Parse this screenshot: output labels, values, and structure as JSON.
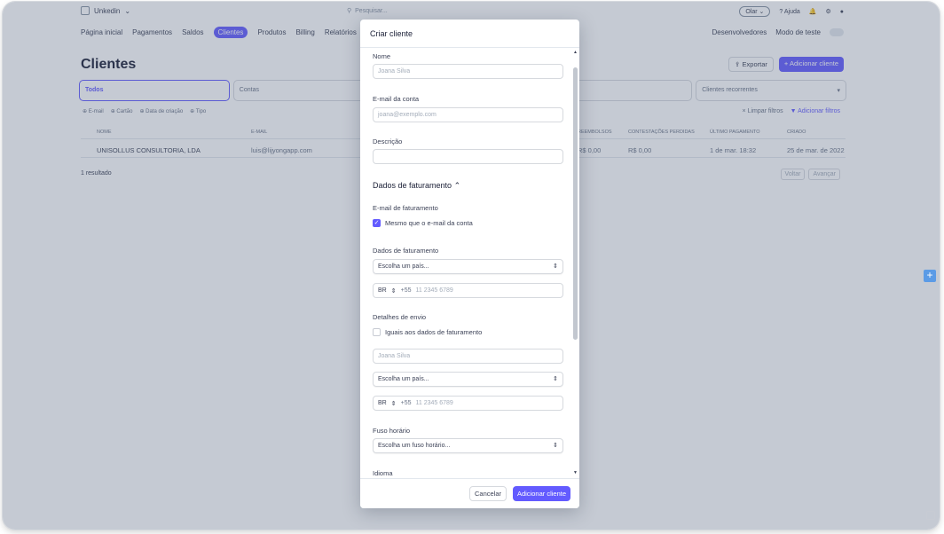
{
  "topbar": {
    "account_name": "Unkedin",
    "search_placeholder": "Pesquisar...",
    "pill": "Olar",
    "help": "Ajuda"
  },
  "nav": {
    "tabs": [
      "Página inicial",
      "Pagamentos",
      "Saldos",
      "Clientes",
      "Produtos",
      "Billing",
      "Relatórios"
    ],
    "active_index": 3,
    "developers": "Desenvolvedores",
    "test_mode": "Modo de teste"
  },
  "page": {
    "title": "Clientes",
    "export": "Exportar",
    "add_customer": "Adicionar cliente",
    "filter_cards": [
      "Todos",
      "Contas",
      "",
      "entes",
      "Clientes recorrentes"
    ],
    "chips": [
      "E-mail",
      "Cartão",
      "Data de criação",
      "Tipo"
    ],
    "clear_filters": "Limpar filtros",
    "add_filters": "Adicionar filtros",
    "columns": [
      "NOME",
      "E-MAIL",
      "REEMBOLSOS",
      "CONTESTAÇÕES PERDIDAS",
      "ÚLTIMO PAGAMENTO",
      "CRIADO"
    ],
    "rows": [
      {
        "name": "UNISOLLUS CONSULTORIA, LDA",
        "email": "luis@lijyongapp.com",
        "refunds": "R$ 0,00",
        "disputes": "R$ 0,00",
        "last_payment": "1 de mar. 18:32",
        "created": "25 de mar. de 2022"
      }
    ],
    "result_count": "1 resultado",
    "prev": "Voltar",
    "next": "Avançar"
  },
  "modal": {
    "title": "Criar cliente",
    "name_label": "Nome",
    "name_placeholder": "Joana Silva",
    "email_label": "E-mail da conta",
    "email_placeholder": "joana@exemplo.com",
    "description_label": "Descrição",
    "billing_section": "Dados de faturamento",
    "billing_email_label": "E-mail de faturamento",
    "same_email_label": "Mesmo que o e-mail da conta",
    "billing_data_label": "Dados de faturamento",
    "country_placeholder": "Escolha um país...",
    "phone_cc": "BR",
    "phone_prefix": "+55",
    "phone_placeholder": "11 2345 6789",
    "shipping_label": "Detalhes de envio",
    "same_billing_label": "Iguais aos dados de faturamento",
    "ship_name_placeholder": "Joana Silva",
    "ship_country_placeholder": "Escolha um país...",
    "ship_phone_cc": "BR",
    "ship_phone_prefix": "+55",
    "ship_phone_placeholder": "11 2345 6789",
    "timezone_label": "Fuso horário",
    "timezone_placeholder": "Escolha um fuso horário...",
    "language_label": "Idioma",
    "cancel": "Cancelar",
    "submit": "Adicionar cliente"
  },
  "colors": {
    "accent": "#635bff",
    "overlay": "rgba(80,94,120,0.33)"
  }
}
